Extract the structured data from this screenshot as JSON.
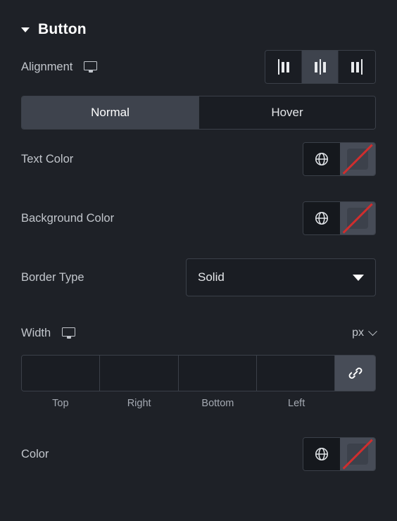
{
  "section": {
    "title": "Button",
    "collapse_icon": "chevron-down-icon"
  },
  "rows": {
    "alignment": {
      "label": "Alignment",
      "device_icon": "monitor-icon",
      "options": [
        {
          "value": "left",
          "icon": "align-left-icon",
          "active": false
        },
        {
          "value": "center",
          "icon": "align-center-icon",
          "active": true
        },
        {
          "value": "right",
          "icon": "align-right-icon",
          "active": false
        }
      ]
    },
    "state_tabs": {
      "normal_label": "Normal",
      "hover_label": "Hover",
      "active": "Normal"
    },
    "text_color": {
      "label": "Text Color",
      "globe_icon": "globe-icon",
      "swatch_icon": "no-color-swatch-icon",
      "value": ""
    },
    "background_color": {
      "label": "Background Color",
      "globe_icon": "globe-icon",
      "swatch_icon": "no-color-swatch-icon",
      "value": ""
    },
    "border_type": {
      "label": "Border Type",
      "value": "Solid",
      "caret_icon": "chevron-down-icon"
    },
    "width": {
      "label": "Width",
      "device_icon": "monitor-icon",
      "unit": "px",
      "unit_caret_icon": "chevron-down-icon",
      "link_icon": "link-chain-icon",
      "linked": true,
      "inputs": [
        {
          "name": "top",
          "label": "Top",
          "value": "",
          "placeholder": ""
        },
        {
          "name": "right",
          "label": "Right",
          "value": "",
          "placeholder": ""
        },
        {
          "name": "bottom",
          "label": "Bottom",
          "value": "",
          "placeholder": ""
        },
        {
          "name": "left",
          "label": "Left",
          "value": "",
          "placeholder": ""
        }
      ]
    },
    "color": {
      "label": "Color",
      "globe_icon": "globe-icon",
      "swatch_icon": "no-color-swatch-icon",
      "value": ""
    }
  },
  "colors": {
    "panel_background": "#1e2127",
    "control_background": "#1a1d23",
    "active_background": "#3e434d",
    "border": "#3b4049",
    "label_text": "#c2c6cc",
    "value_text": "#e4e6e9",
    "title_text": "#ffffff",
    "no_color_slash": "#cf2e2e",
    "swatch_background": "#474c57"
  }
}
